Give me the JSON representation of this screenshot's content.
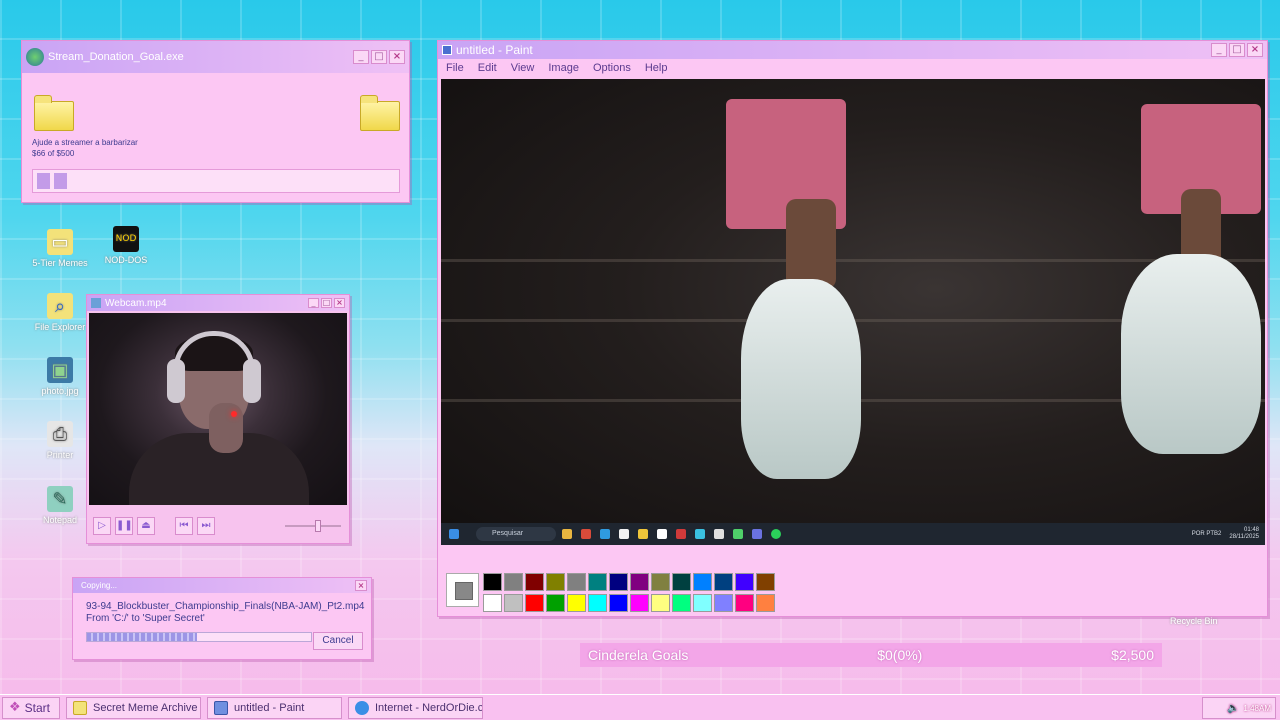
{
  "donation_window": {
    "title": "Stream_Donation_Goal.exe",
    "message": "Ajude a streamer a barbarizar",
    "amount": "$66 of $500",
    "progress_fraction": 0.132
  },
  "desktop_icons": [
    {
      "label": "5-Tier Memes"
    },
    {
      "label": "NOD-DOS"
    },
    {
      "label": "File Explorer"
    },
    {
      "label": "photo.jpg"
    },
    {
      "label": "Printer"
    },
    {
      "label": "Notepad"
    }
  ],
  "webcam_window": {
    "title": "Webcam.mp4",
    "volume_fraction": 0.6
  },
  "paint_window": {
    "title": "untitled - Paint",
    "menu": [
      "File",
      "Edit",
      "View",
      "Image",
      "Options",
      "Help"
    ],
    "screenshot_taskbar": {
      "search": "Pesquisar",
      "clock": "01:48\n28/11/2025",
      "lang": "POR PTB2"
    },
    "palette_row1": [
      "#000000",
      "#808080",
      "#800000",
      "#808000",
      "#808080",
      "#008080",
      "#000080",
      "#800080",
      "#808040",
      "#004040",
      "#0080ff",
      "#004080",
      "#4000ff",
      "#804000"
    ],
    "palette_row2": [
      "#ffffff",
      "#c0c0c0",
      "#ff0000",
      "#00a000",
      "#ffff00",
      "#00ffff",
      "#0000ff",
      "#ff00ff",
      "#ffff80",
      "#00ff80",
      "#80ffff",
      "#8080ff",
      "#ff0080",
      "#ff8040"
    ]
  },
  "copy_dialog": {
    "title": "Copying...",
    "file": "93-94_Blockbuster_Championship_Finals(NBA-JAM)_Pt2.mp4",
    "route": "From 'C:/' to 'Super Secret'",
    "progress_fraction": 0.49,
    "cancel": "Cancel"
  },
  "goals_bar": {
    "label": "Cinderela Goals",
    "current": "$0(0%)",
    "target": "$2,500"
  },
  "recycle_bin": "Recycle Bin",
  "taskbar": {
    "start": "Start",
    "tasks": [
      {
        "label": "Secret Meme Archive",
        "icon": "folder-icon"
      },
      {
        "label": "untitled - Paint",
        "icon": "paint-icon"
      },
      {
        "label": "Internet - NerdOrDie.com",
        "icon": "internet-icon"
      }
    ],
    "clock": "1:48AM"
  }
}
